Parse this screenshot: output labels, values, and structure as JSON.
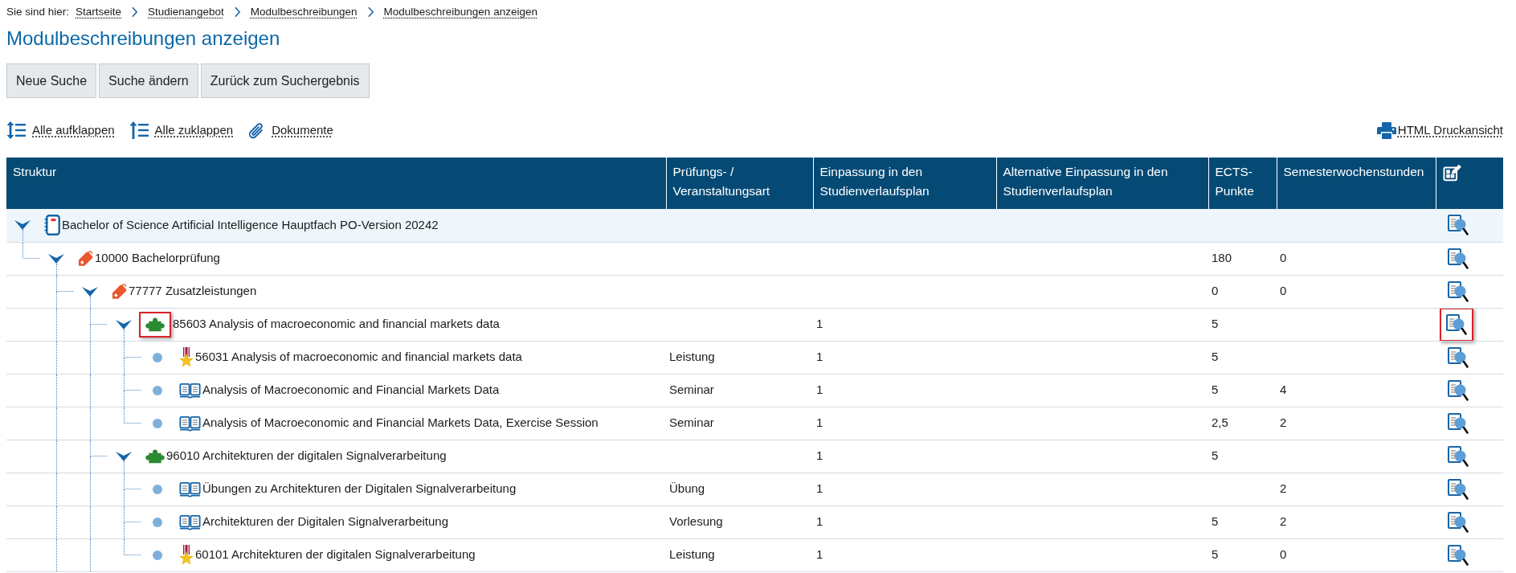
{
  "breadcrumb": {
    "label": "Sie sind hier:",
    "items": [
      "Startseite",
      "Studienangebot",
      "Modulbeschreibungen",
      "Modulbeschreibungen anzeigen"
    ]
  },
  "title": "Modulbeschreibungen anzeigen",
  "buttons": [
    "Neue Suche",
    "Suche ändern",
    "Zurück zum Suchergebnis"
  ],
  "actions": [
    {
      "kind": "expand",
      "text": "Alle aufklappen"
    },
    {
      "kind": "collapse",
      "text": "Alle zuklappen"
    },
    {
      "kind": "documents",
      "text": "Dokumente"
    }
  ],
  "print_link": {
    "text": "HTML Druckansicht"
  },
  "table": {
    "columns": [
      "Struktur",
      "Prüfungs- / Veranstaltungsart",
      "Einpassung in den Studienverlaufsplan",
      "Alternative Einpassung in den Studienverlaufsplan",
      "ECTS-Punkte",
      "Semesterwochenstunden"
    ],
    "rows": [
      {
        "kind": "program",
        "text": "Bachelor of Science Artificial Intelligence Hauptfach PO-Version 20242",
        "selected": true,
        "icon_highlighted": false,
        "view_highlighted": false,
        "expanded": true,
        "more_below": false,
        "children": [
          {
            "kind": "group",
            "text": "10000 Bachelorprüfung",
            "ects": "180",
            "sws": "0",
            "selected": false,
            "icon_highlighted": false,
            "view_highlighted": false,
            "expanded": true,
            "more_below": true,
            "children": [
              {
                "kind": "group",
                "text": "77777 Zusatzleistungen",
                "ects": "0",
                "sws": "0",
                "selected": false,
                "icon_highlighted": false,
                "view_highlighted": false,
                "expanded": true,
                "more_below": true,
                "children": [
                  {
                    "kind": "module",
                    "text": "85603 Analysis of macroeconomic and financial markets data",
                    "plan_semester": "1",
                    "ects": "5",
                    "selected": false,
                    "icon_highlighted": true,
                    "view_highlighted": true,
                    "expanded": true,
                    "more_below": false,
                    "children": [
                      {
                        "kind": "exam",
                        "text": "56031 Analysis of macroeconomic and financial markets data",
                        "type": "Leistung",
                        "plan_semester": "1",
                        "ects": "5",
                        "selected": false,
                        "icon_highlighted": false,
                        "view_highlighted": false
                      },
                      {
                        "kind": "course",
                        "text": "Analysis of Macroeconomic and Financial Markets Data",
                        "type": "Seminar",
                        "plan_semester": "1",
                        "ects": "5",
                        "sws": "4",
                        "selected": false,
                        "icon_highlighted": false,
                        "view_highlighted": false
                      },
                      {
                        "kind": "course",
                        "text": "Analysis of Macroeconomic and Financial Markets Data, Exercise Session",
                        "type": "Seminar",
                        "plan_semester": "1",
                        "ects": "2,5",
                        "sws": "2",
                        "selected": false,
                        "icon_highlighted": false,
                        "view_highlighted": false
                      }
                    ]
                  },
                  {
                    "kind": "module",
                    "text": "96010 Architekturen der digitalen Signalverarbeitung",
                    "plan_semester": "1",
                    "ects": "5",
                    "selected": false,
                    "icon_highlighted": false,
                    "view_highlighted": false,
                    "expanded": true,
                    "more_below": false,
                    "children": [
                      {
                        "kind": "course",
                        "text": "Übungen zu Architekturen der Digitalen Signalverarbeitung",
                        "type": "Übung",
                        "plan_semester": "1",
                        "sws": "2",
                        "selected": false,
                        "icon_highlighted": false,
                        "view_highlighted": false
                      },
                      {
                        "kind": "course",
                        "text": "Architekturen der Digitalen Signalverarbeitung",
                        "type": "Vorlesung",
                        "plan_semester": "1",
                        "ects": "5",
                        "sws": "2",
                        "selected": false,
                        "icon_highlighted": false,
                        "view_highlighted": false
                      },
                      {
                        "kind": "exam",
                        "text": "60101 Architekturen der digitalen Signalverarbeitung",
                        "type": "Leistung",
                        "plan_semester": "1",
                        "ects": "5",
                        "sws": "0",
                        "selected": false,
                        "icon_highlighted": false,
                        "view_highlighted": false
                      }
                    ]
                  }
                ]
              }
            ]
          }
        ]
      }
    ]
  }
}
